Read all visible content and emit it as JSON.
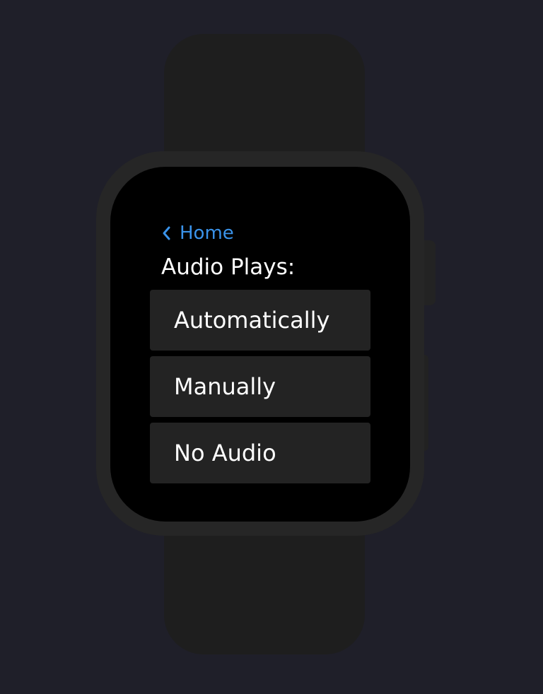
{
  "header": {
    "back_label": "Home"
  },
  "section": {
    "title": "Audio Plays:"
  },
  "options": [
    {
      "label": "Automatically"
    },
    {
      "label": "Manually"
    },
    {
      "label": "No Audio"
    }
  ],
  "colors": {
    "background": "#1f1f29",
    "accent": "#3a93ea",
    "screen": "#000000",
    "option_bg": "#232323",
    "text": "#ffffff"
  },
  "icons": {
    "back": "chevron-left-icon"
  }
}
